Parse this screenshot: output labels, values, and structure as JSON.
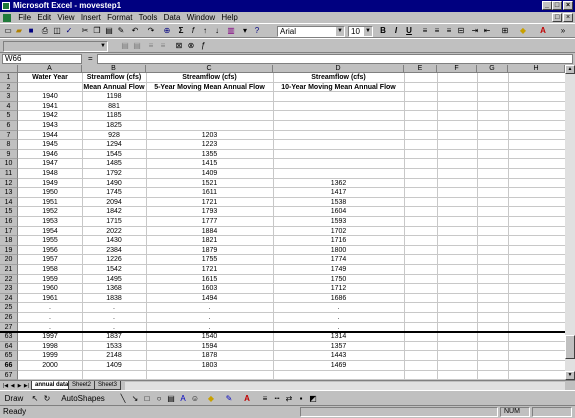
{
  "window": {
    "title": "Microsoft Excel - movestep1"
  },
  "menu": [
    "File",
    "Edit",
    "View",
    "Insert",
    "Format",
    "Tools",
    "Data",
    "Window",
    "Help"
  ],
  "toolbar": {
    "font_name": "Arial",
    "font_size": "10",
    "bold": "B",
    "italic": "I",
    "underline": "U"
  },
  "formula_bar": {
    "name_box": "W66",
    "equals": "=",
    "formula": ""
  },
  "columns": [
    "A",
    "B",
    "C",
    "D",
    "E",
    "F",
    "G",
    "H"
  ],
  "header_rows": {
    "r1": {
      "A": "Water Year",
      "B": "Streamflow (cfs)",
      "C": "Streamflow (cfs)",
      "D": "Streamflow (cfs)"
    },
    "r2": {
      "B": "Mean Annual Flow",
      "C": "5-Year Moving Mean Annual Flow",
      "D": "10-Year Moving Mean Annual Flow"
    }
  },
  "rows": [
    {
      "row": "1",
      "a": "",
      "b": "",
      "c": "",
      "d": ""
    },
    {
      "row": "2",
      "a": "",
      "b": "",
      "c": "",
      "d": ""
    },
    {
      "row": "3",
      "a": "1940",
      "b": "1198",
      "c": "",
      "d": ""
    },
    {
      "row": "4",
      "a": "1941",
      "b": "881",
      "c": "",
      "d": ""
    },
    {
      "row": "5",
      "a": "1942",
      "b": "1185",
      "c": "",
      "d": ""
    },
    {
      "row": "6",
      "a": "1943",
      "b": "1825",
      "c": "",
      "d": ""
    },
    {
      "row": "7",
      "a": "1944",
      "b": "928",
      "c": "1203",
      "d": ""
    },
    {
      "row": "8",
      "a": "1945",
      "b": "1294",
      "c": "1223",
      "d": ""
    },
    {
      "row": "9",
      "a": "1946",
      "b": "1545",
      "c": "1355",
      "d": ""
    },
    {
      "row": "10",
      "a": "1947",
      "b": "1485",
      "c": "1415",
      "d": ""
    },
    {
      "row": "11",
      "a": "1948",
      "b": "1792",
      "c": "1409",
      "d": ""
    },
    {
      "row": "12",
      "a": "1949",
      "b": "1490",
      "c": "1521",
      "d": "1362"
    },
    {
      "row": "13",
      "a": "1950",
      "b": "1745",
      "c": "1611",
      "d": "1417"
    },
    {
      "row": "14",
      "a": "1951",
      "b": "2094",
      "c": "1721",
      "d": "1538"
    },
    {
      "row": "15",
      "a": "1952",
      "b": "1842",
      "c": "1793",
      "d": "1604"
    },
    {
      "row": "16",
      "a": "1953",
      "b": "1715",
      "c": "1777",
      "d": "1593"
    },
    {
      "row": "17",
      "a": "1954",
      "b": "2022",
      "c": "1884",
      "d": "1702"
    },
    {
      "row": "18",
      "a": "1955",
      "b": "1430",
      "c": "1821",
      "d": "1716"
    },
    {
      "row": "19",
      "a": "1956",
      "b": "2384",
      "c": "1879",
      "d": "1800"
    },
    {
      "row": "20",
      "a": "1957",
      "b": "1226",
      "c": "1755",
      "d": "1774"
    },
    {
      "row": "21",
      "a": "1958",
      "b": "1542",
      "c": "1721",
      "d": "1749"
    },
    {
      "row": "22",
      "a": "1959",
      "b": "1495",
      "c": "1615",
      "d": "1750"
    },
    {
      "row": "23",
      "a": "1960",
      "b": "1368",
      "c": "1603",
      "d": "1712"
    },
    {
      "row": "24",
      "a": "1961",
      "b": "1838",
      "c": "1494",
      "d": "1686"
    },
    {
      "row": "25",
      "a": ".",
      "b": ".",
      "c": ".",
      "d": "."
    },
    {
      "row": "26",
      "a": ".",
      "b": ".",
      "c": ".",
      "d": "."
    },
    {
      "row": "27",
      "a": ".",
      "b": ".",
      "c": ".",
      "d": "."
    },
    {
      "row": "63",
      "a": "1997",
      "b": "1837",
      "c": "1540",
      "d": "1314"
    },
    {
      "row": "64",
      "a": "1998",
      "b": "1533",
      "c": "1594",
      "d": "1357"
    },
    {
      "row": "65",
      "a": "1999",
      "b": "2148",
      "c": "1878",
      "d": "1443"
    },
    {
      "row": "66",
      "a": "2000",
      "b": "1409",
      "c": "1803",
      "d": "1469"
    },
    {
      "row": "67",
      "a": "",
      "b": "",
      "c": "",
      "d": ""
    }
  ],
  "sheet_tabs": [
    "annual data",
    "Sheet2",
    "Sheet3"
  ],
  "drawing": {
    "draw_label": "Draw",
    "autoshapes_label": "AutoShapes"
  },
  "status": {
    "text": "Ready",
    "num": "NUM"
  }
}
